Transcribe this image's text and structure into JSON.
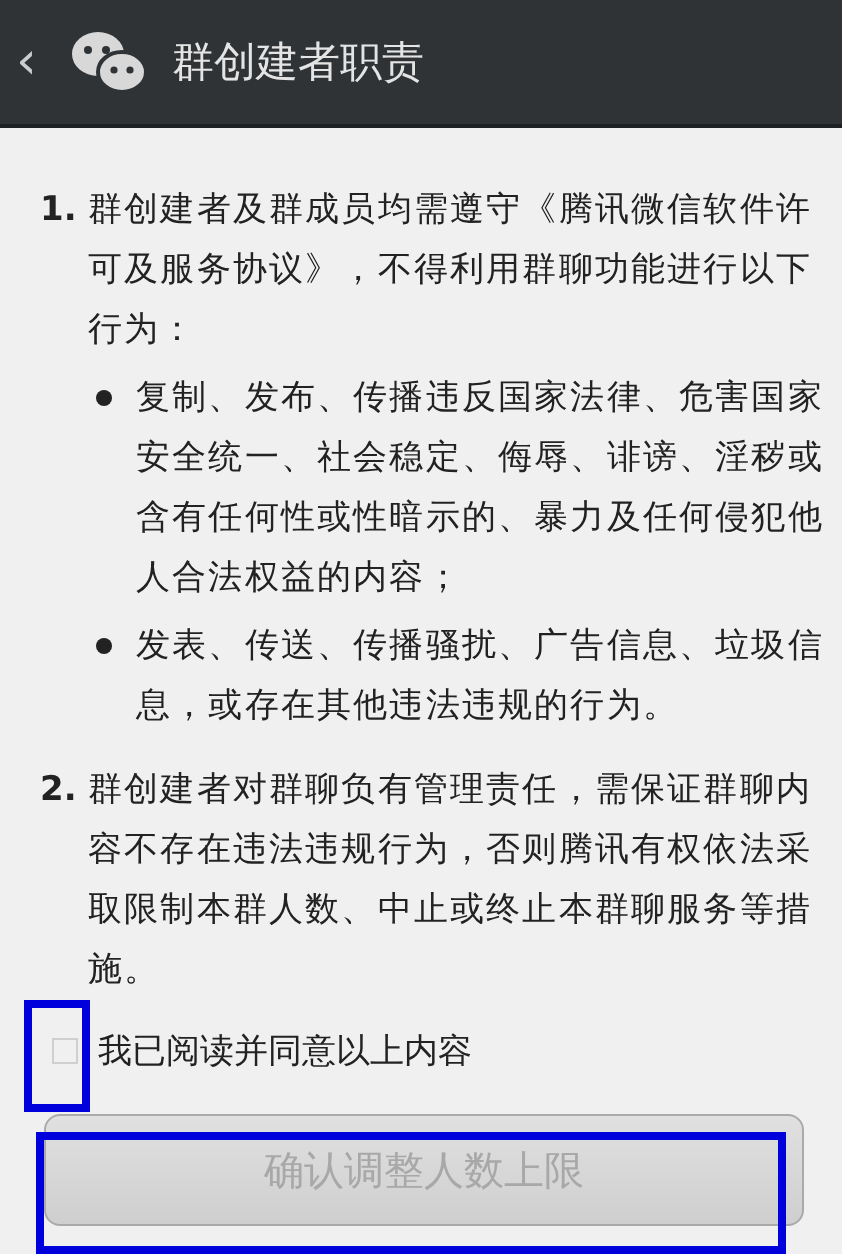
{
  "header": {
    "back": "‹",
    "title": "群创建者职责"
  },
  "items": [
    {
      "number": "1.",
      "text": "群创建者及群成员均需遵守《腾讯微信软件许可及服务协议》，不得利用群聊功能进行以下行为：",
      "bullets": [
        "复制、发布、传播违反国家法律、危害国家安全统一、社会稳定、侮辱、诽谤、淫秽或含有任何性或性暗示的、暴力及任何侵犯他人合法权益的内容；",
        "发表、传送、传播骚扰、广告信息、垃圾信息，或存在其他违法违规的行为。"
      ]
    },
    {
      "number": "2.",
      "text": "群创建者对群聊负有管理责任，需保证群聊内容不存在违法违规行为，否则腾讯有权依法采取限制本群人数、中止或终止本群聊服务等措施。"
    }
  ],
  "agree": {
    "label": "我已阅读并同意以上内容",
    "checked": false
  },
  "confirm": {
    "label": "确认调整人数上限",
    "disabled": true
  }
}
